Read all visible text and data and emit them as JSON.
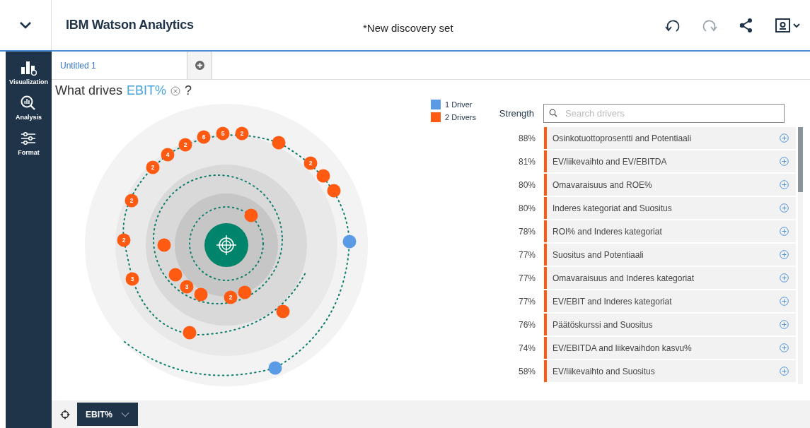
{
  "header": {
    "app_title": "IBM Watson Analytics",
    "document_title": "*New discovery set",
    "toolbar": [
      {
        "kind": "undo",
        "disabled": false
      },
      {
        "kind": "redo",
        "disabled": true
      },
      {
        "kind": "share",
        "disabled": false
      },
      {
        "kind": "account",
        "disabled": false
      }
    ]
  },
  "sidebar": {
    "items": [
      {
        "kind": "visualization",
        "label": "Visualization"
      },
      {
        "kind": "analysis",
        "label": "Analysis"
      },
      {
        "kind": "format",
        "label": "Format"
      }
    ]
  },
  "tabs": [
    {
      "label": "Untitled 1",
      "selected": true
    }
  ],
  "question": {
    "prefix": "What drives",
    "target": "EBIT%",
    "suffix": "?"
  },
  "legend": [
    {
      "label": "1 Driver",
      "color": "#5b9be6"
    },
    {
      "label": "2 Drivers",
      "color": "#ff5a12"
    }
  ],
  "bubbles": [
    {
      "label": "2",
      "color": "#ff5a12"
    },
    {
      "label": "2",
      "color": "#ff5a12"
    },
    {
      "label": "4",
      "color": "#ff5a12"
    },
    {
      "label": "2",
      "color": "#ff5a12"
    },
    {
      "label": "6",
      "color": "#ff5a12"
    },
    {
      "label": "5",
      "color": "#ff5a12"
    },
    {
      "label": "2",
      "color": "#ff5a12"
    },
    {
      "color": "#ff5a12"
    },
    {
      "label": "2",
      "color": "#ff5a12"
    },
    {
      "color": "#ff5a12"
    },
    {
      "color": "#ff5a12"
    },
    {
      "color": "#5b9be6"
    },
    {
      "color": "#ff5a12"
    },
    {
      "color": "#5b9be6"
    },
    {
      "color": "#ff5a12"
    },
    {
      "label": "3",
      "color": "#ff5a12"
    },
    {
      "label": "2",
      "color": "#ff5a12"
    },
    {
      "color": "#ff5a12"
    },
    {
      "color": "#ff5a12"
    },
    {
      "label": "3",
      "color": "#ff5a12"
    },
    {
      "color": "#ff5a12"
    },
    {
      "label": "2",
      "color": "#ff5a12"
    },
    {
      "color": "#ff5a12"
    },
    {
      "color": "#ff5a12"
    }
  ],
  "drivers_panel": {
    "strength_label": "Strength",
    "search": {
      "placeholder": "Search drivers"
    },
    "rows": [
      {
        "strength": "88%",
        "label": "Osinkotuottoprosentti and Potentiaali"
      },
      {
        "strength": "81%",
        "label": "EV/liikevaihto and EV/EBITDA"
      },
      {
        "strength": "80%",
        "label": "Omavaraisuus and ROE%"
      },
      {
        "strength": "80%",
        "label": "Inderes kategoriat and Suositus"
      },
      {
        "strength": "78%",
        "label": "ROI% and Inderes kategoriat"
      },
      {
        "strength": "77%",
        "label": "Suositus and Potentiaali"
      },
      {
        "strength": "77%",
        "label": "Omavaraisuus and Inderes kategoriat"
      },
      {
        "strength": "77%",
        "label": "EV/EBIT and Inderes kategoriat"
      },
      {
        "strength": "76%",
        "label": "Päätöskurssi and Suositus"
      },
      {
        "strength": "74%",
        "label": "EV/EBITDA and liikevaihdon kasvu%"
      },
      {
        "strength": "58%",
        "label": "EV/liikevaihto and Suositus"
      }
    ]
  },
  "bottom_bar": {
    "target_label": "EBIT%"
  }
}
